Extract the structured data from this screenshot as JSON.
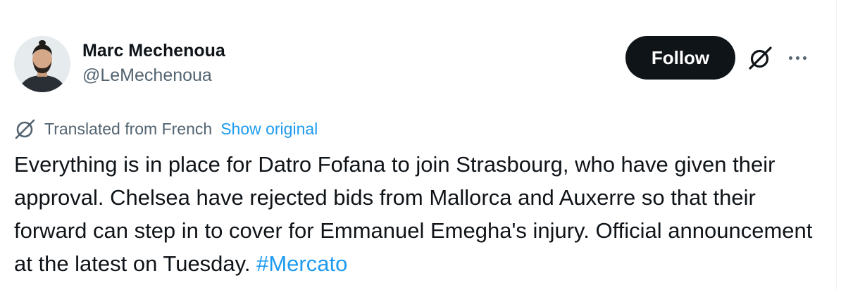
{
  "author": {
    "display_name": "Marc Mechenoua",
    "handle": "@LeMechenoua"
  },
  "actions": {
    "follow_label": "Follow",
    "grok_icon": "grok-icon",
    "more_icon": "more-icon"
  },
  "translation": {
    "label": "Translated from French",
    "show_original": "Show original"
  },
  "tweet": {
    "text": "Everything is in place for Datro Fofana to join Strasbourg, who have given their approval. Chelsea have rejected bids from Mallorca and Auxerre so that their forward can step in to cover for Emmanuel Emegha's injury. Official announcement at the latest on Tuesday.",
    "hashtag": "#Mercato"
  },
  "colors": {
    "text": "#0f1419",
    "secondary": "#536471",
    "link": "#1d9bf0",
    "follow_bg": "#0f1419"
  }
}
